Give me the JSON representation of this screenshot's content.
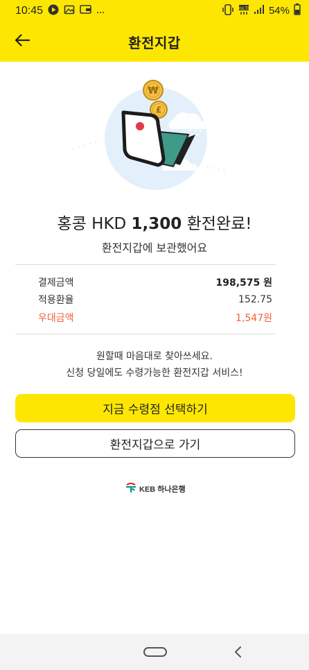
{
  "status_bar": {
    "time": "10:45",
    "left_icons": [
      "play-icon",
      "image-icon",
      "wallet-icon",
      "more-dots-icon"
    ],
    "battery_percent": "54%",
    "right_icons": [
      "vibrate-icon",
      "hd-voice-icon",
      "signal-icon",
      "battery-icon"
    ]
  },
  "app_bar": {
    "title": "환전지갑",
    "back_icon": "arrow-left-icon"
  },
  "colors": {
    "brand_yellow": "#fde702",
    "promo_red": "#f2603a",
    "illustration_bg": "#e3f0fb",
    "coin_gold": "#f4c244",
    "wallet_teal": "#3f9a8a"
  },
  "result": {
    "headline_prefix": "홍콩 HKD ",
    "headline_amount": "1,300",
    "headline_suffix": " 환전완료!",
    "subline": "환전지갑에 보관했어요"
  },
  "summary": [
    {
      "label": "결제금액",
      "value": "198,575 원"
    },
    {
      "label": "적용환율",
      "value": "152.75"
    },
    {
      "label": "우대금액",
      "value": "1,547원"
    }
  ],
  "notice": {
    "line1": "원할때 마음대로 찾아쓰세요.",
    "line2": "신청 당일에도 수령가능한 환전지갑 서비스!"
  },
  "buttons": {
    "primary": "지금 수령점 선택하기",
    "secondary": "환전지갑으로 가기"
  },
  "brand": {
    "text": "KEB 하나은행",
    "logo_icon": "hana-bank-logo-icon"
  },
  "nav_bar": {
    "home_icon": "home-pill-icon",
    "back_icon": "back-chevron-icon"
  },
  "illustration": {
    "coin1_symbol": "₩",
    "coin2_symbol": "£"
  }
}
